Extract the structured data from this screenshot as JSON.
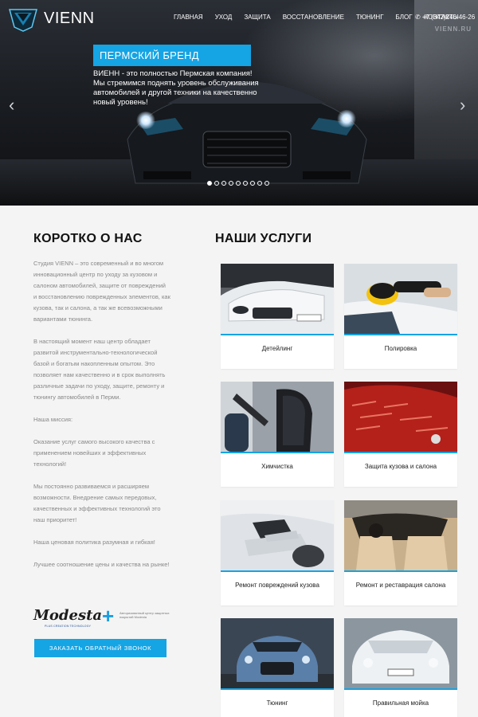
{
  "header": {
    "logo_text": "VIENN",
    "nav": [
      "ГЛАВНАЯ",
      "УХОД",
      "ЗАЩИТА",
      "ВОССТАНОВЛЕНИЕ",
      "ТЮНИНГ",
      "БЛОГ",
      "КОНТАКТЫ"
    ],
    "phone": "+7 (342)240-46-26",
    "phone_icon": "phone-icon"
  },
  "hero": {
    "title": "ПЕРМСКИЙ БРЕНД",
    "text": "ВИЕНН - это полностью Пермская компания! Мы стремимся поднять уровень обслуживания автомобилей и другой техники на качественно новый уровень!",
    "sign": "VIENN.RU",
    "slide_count": 9,
    "active_slide": 1,
    "arrow_left": "‹",
    "arrow_right": "›"
  },
  "about": {
    "title": "КОРОТКО О НАС",
    "paragraphs": [
      "Студия VIENN – это современный и во многом инновационный центр по уходу за кузовом и салоном автомобилей, защите от повреждений и восстановлению поврежденных элементов, как кузова, так и салона, а так же всевозможными вариантами тюнинга.",
      "В настоящий момент наш центр обладает развитой инструментально-технологической базой и богатым накопленным опытом. Это позволяет нам качественно и в срок выполнять различные задачи по уходу, защите, ремонту и тюнингу автомобилей в Перми.",
      "Наша миссия:",
      "Оказание услуг самого высокого качества с применением новейших и эффективных технологий!",
      "Мы постоянно развиваемся и расширяем возможности. Внедрение самых передовых, качественных и эффективных технологий это наш приоритет!",
      "Наша ценовая политика разумная и гибкая!",
      "Лучшее соотношение цены и качества на рынке!"
    ],
    "partner_name": "Modesta",
    "partner_sub": "PLUS CREATION TECHNOLOGY",
    "partner_plus": "+",
    "partner_note": "Авторизованный центр защитных покрытий Modesta",
    "callback_label": "ЗАКАЗАТЬ ОБРАТНЫЙ ЗВОНОК"
  },
  "services": {
    "title": "НАШИ УСЛУГИ",
    "items": [
      {
        "label": "Детейлинг"
      },
      {
        "label": "Полировка"
      },
      {
        "label": "Химчистка"
      },
      {
        "label": "Защита кузова и салона"
      },
      {
        "label": "Ремонт повреждений кузова"
      },
      {
        "label": "Ремонт и реставрация салона"
      },
      {
        "label": "Тюнинг"
      },
      {
        "label": "Правильная мойка"
      }
    ]
  },
  "colors": {
    "accent": "#15a4e4",
    "hero_dark": "#1b1e23",
    "page_bg": "#f4f4f4"
  }
}
